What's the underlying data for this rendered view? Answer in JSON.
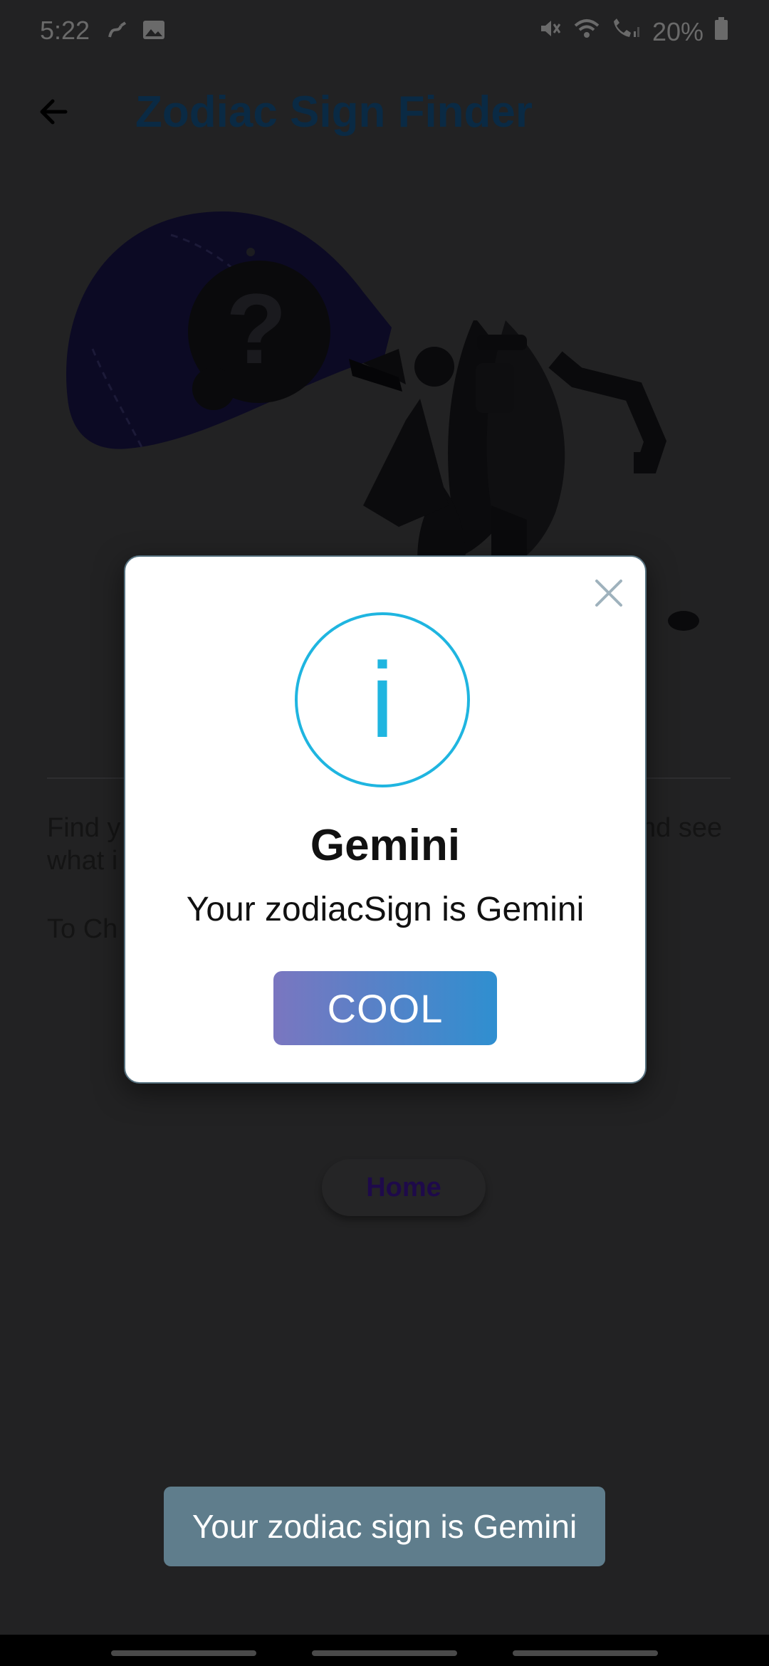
{
  "status_bar": {
    "time": "5:22",
    "battery": "20%"
  },
  "app_bar": {
    "title": "Zodiac Sign Finder",
    "back_icon": "arrow-left-icon"
  },
  "background": {
    "line1_left": "Find y",
    "line1_right": "nd see",
    "line2_left": "what i",
    "line3_left": "To Ch",
    "home_button": "Home"
  },
  "dialog": {
    "icon_glyph": "i",
    "title": "Gemini",
    "message": "Your zodiacSign is Gemini",
    "confirm_button": "COOL"
  },
  "toast": {
    "message": "Your zodiac sign is Gemini"
  },
  "colors": {
    "accent": "#1fb5e0",
    "toast": "#5f7d8c",
    "title": "#0a2a44"
  }
}
